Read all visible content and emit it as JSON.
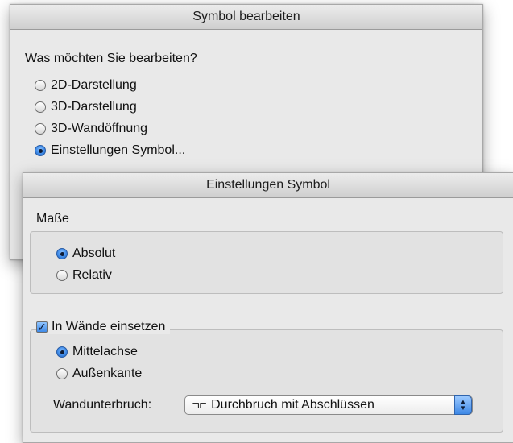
{
  "dialog_symbol": {
    "title": "Symbol bearbeiten",
    "question": "Was möchten Sie bearbeiten?",
    "options": [
      {
        "label": "2D-Darstellung",
        "selected": false
      },
      {
        "label": "3D-Darstellung",
        "selected": false
      },
      {
        "label": "3D-Wandöffnung",
        "selected": false
      },
      {
        "label": "Einstellungen Symbol...",
        "selected": true
      }
    ]
  },
  "dialog_settings": {
    "title": "Einstellungen Symbol",
    "masse": {
      "label": "Maße",
      "options": [
        {
          "label": "Absolut",
          "selected": true
        },
        {
          "label": "Relativ",
          "selected": false
        }
      ]
    },
    "walls": {
      "checkbox_label": "In Wände einsetzen",
      "checked": true,
      "options": [
        {
          "label": "Mittelachse",
          "selected": true
        },
        {
          "label": "Außenkante",
          "selected": false
        }
      ],
      "wandunterbruch_label": "Wandunterbruch:",
      "wandunterbruch_value": "Durchbruch mit Abschlüssen",
      "wandunterbruch_glyph": "⊐⊏"
    }
  },
  "colors": {
    "accent": "#3f8be8",
    "dialog_bg": "#e9e9e9"
  }
}
